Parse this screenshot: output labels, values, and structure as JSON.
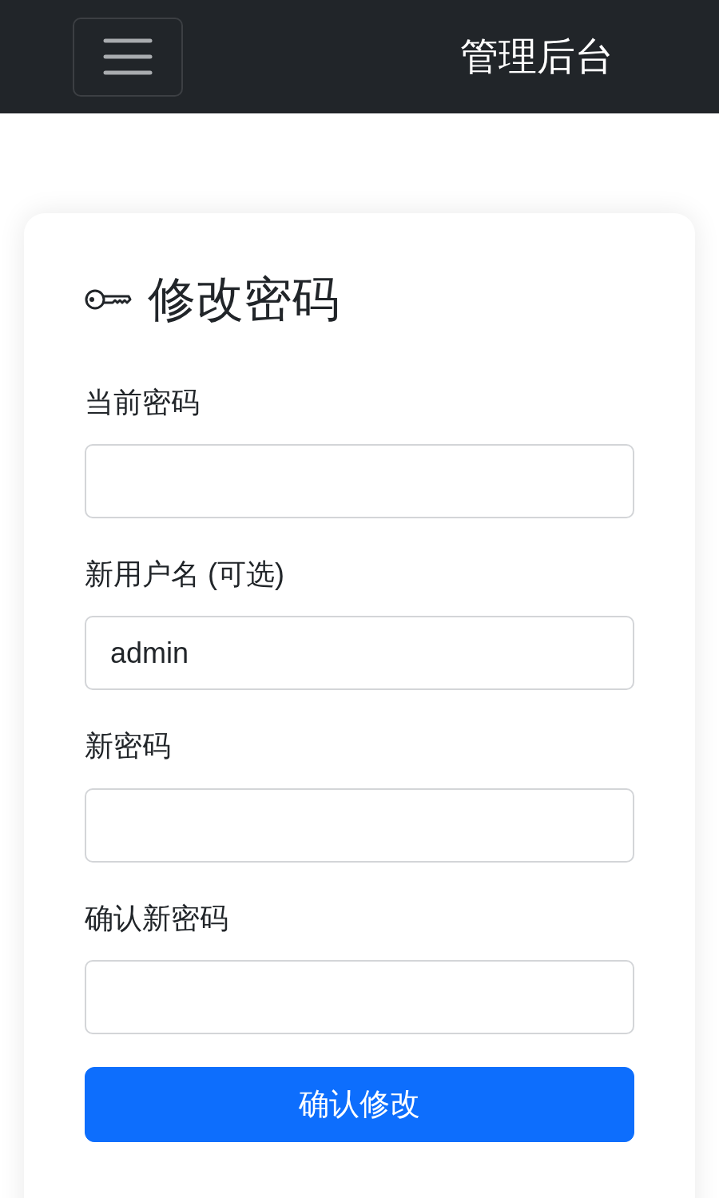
{
  "navbar": {
    "brand": "管理后台"
  },
  "form": {
    "title": "修改密码",
    "fields": [
      {
        "label": "当前密码"
      },
      {
        "label": "新用户名 (可选)",
        "value": "admin"
      },
      {
        "label": "新密码"
      },
      {
        "label": "确认新密码"
      }
    ],
    "submit": "确认修改"
  }
}
